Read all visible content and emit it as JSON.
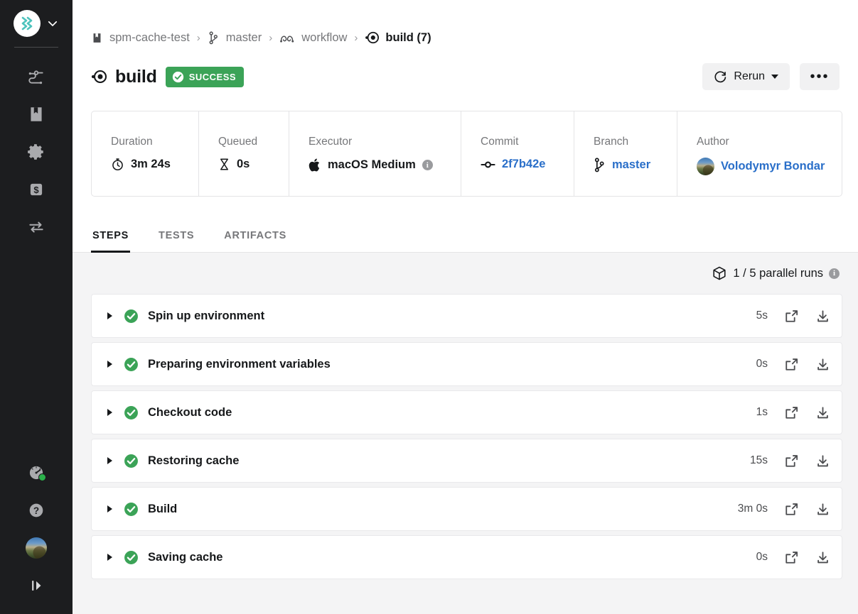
{
  "sidebar": {
    "org": {
      "name": "org-switcher",
      "logo_icon": "circleci-logo-icon",
      "chevron_icon": "chevron-down-icon"
    },
    "items": [
      {
        "icon": "pipelines-icon",
        "name": "sidebar-item-pipelines"
      },
      {
        "icon": "projects-icon",
        "name": "sidebar-item-projects"
      },
      {
        "icon": "gear-icon",
        "name": "sidebar-item-organization-settings"
      },
      {
        "icon": "dollar-plan-icon",
        "name": "sidebar-item-plan"
      },
      {
        "icon": "swap-arrows-icon",
        "name": "sidebar-item-insights"
      }
    ],
    "bottom_items": [
      {
        "icon": "status-gauge-icon",
        "name": "sidebar-item-status",
        "status_color": "#2bb14b"
      },
      {
        "icon": "help-circle-icon",
        "name": "sidebar-item-help"
      },
      {
        "icon": "user-avatar",
        "name": "sidebar-item-user-avatar"
      },
      {
        "icon": "expand-sidebar-icon",
        "name": "sidebar-item-expand"
      }
    ]
  },
  "breadcrumb": {
    "project": "spm-cache-test",
    "branch": "master",
    "workflow": "workflow",
    "job": "build (7)",
    "separator": "›"
  },
  "header": {
    "title": "build",
    "status": "SUCCESS",
    "status_color": "#3ba357",
    "rerun_label": "Rerun",
    "more_label": "•••"
  },
  "info": {
    "duration": {
      "label": "Duration",
      "value": "3m 24s"
    },
    "queued": {
      "label": "Queued",
      "value": "0s"
    },
    "executor": {
      "label": "Executor",
      "value": "macOS Medium"
    },
    "commit": {
      "label": "Commit",
      "value": "2f7b42e"
    },
    "branch": {
      "label": "Branch",
      "value": "master"
    },
    "author": {
      "label": "Author",
      "value": "Volodymyr Bondar"
    },
    "link_color": "#2a6fc9"
  },
  "tabs": [
    {
      "label": "STEPS",
      "active": true
    },
    {
      "label": "TESTS",
      "active": false
    },
    {
      "label": "ARTIFACTS",
      "active": false
    }
  ],
  "parallel": {
    "text": "1 / 5 parallel runs",
    "index": 1,
    "total": 5
  },
  "steps": [
    {
      "name": "Spin up environment",
      "duration": "5s",
      "status": "success"
    },
    {
      "name": "Preparing environment variables",
      "duration": "0s",
      "status": "success"
    },
    {
      "name": "Checkout code",
      "duration": "1s",
      "status": "success"
    },
    {
      "name": "Restoring cache",
      "duration": "15s",
      "status": "success"
    },
    {
      "name": "Build",
      "duration": "3m 0s",
      "status": "success"
    },
    {
      "name": "Saving cache",
      "duration": "0s",
      "status": "success"
    }
  ]
}
